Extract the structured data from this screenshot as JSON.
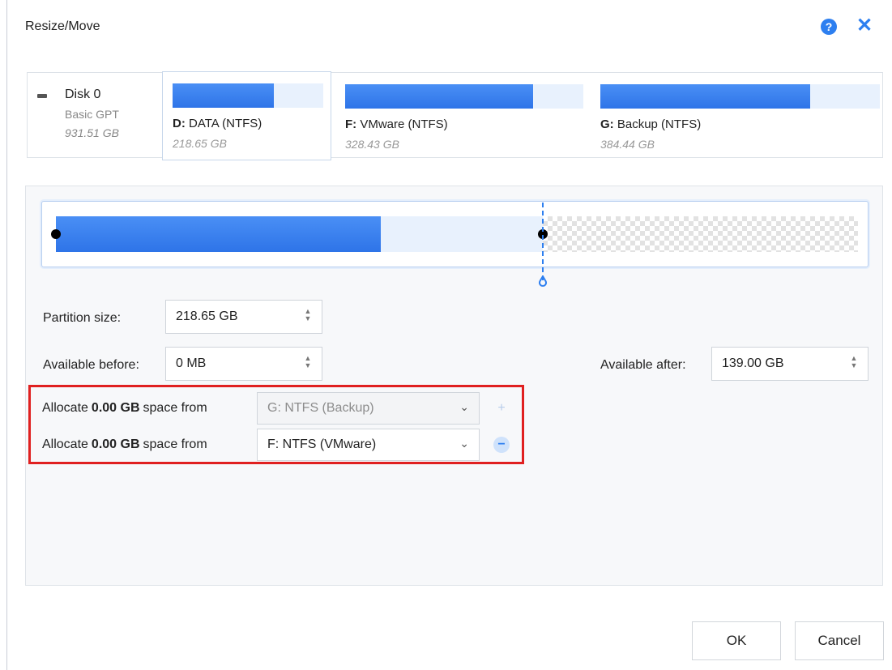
{
  "dialog": {
    "title": "Resize/Move",
    "help_icon": "question-circle-icon",
    "close_icon": "close-icon",
    "accent_color": "#2d7ff0"
  },
  "disk": {
    "name": "Disk 0",
    "type": "Basic GPT",
    "size": "931.51 GB"
  },
  "partitions": [
    {
      "letter": "D:",
      "label": "DATA (NTFS)",
      "size": "218.65 GB",
      "used_fraction": 0.67,
      "selected": true
    },
    {
      "letter": "F:",
      "label": "VMware (NTFS)",
      "size": "328.43 GB",
      "used_fraction": 0.79,
      "selected": false
    },
    {
      "letter": "G:",
      "label": "Backup (NTFS)",
      "size": "384.44 GB",
      "used_fraction": 0.75,
      "selected": false
    }
  ],
  "fields": {
    "partition_size_label": "Partition size:",
    "partition_size_value": "218.65 GB",
    "available_before_label": "Available before:",
    "available_before_value": "0 MB",
    "available_after_label": "Available after:",
    "available_after_value": "139.00 GB"
  },
  "allocate_rows": [
    {
      "prefix": "Allocate",
      "amount": "0.00 GB",
      "suffix": "space from",
      "source": "G: NTFS (Backup)",
      "enabled": false,
      "action": "+"
    },
    {
      "prefix": "Allocate",
      "amount": "0.00 GB",
      "suffix": "space from",
      "source": "F: NTFS (VMware)",
      "enabled": true,
      "action": "−"
    }
  ],
  "buttons": {
    "ok": "OK",
    "cancel": "Cancel"
  }
}
